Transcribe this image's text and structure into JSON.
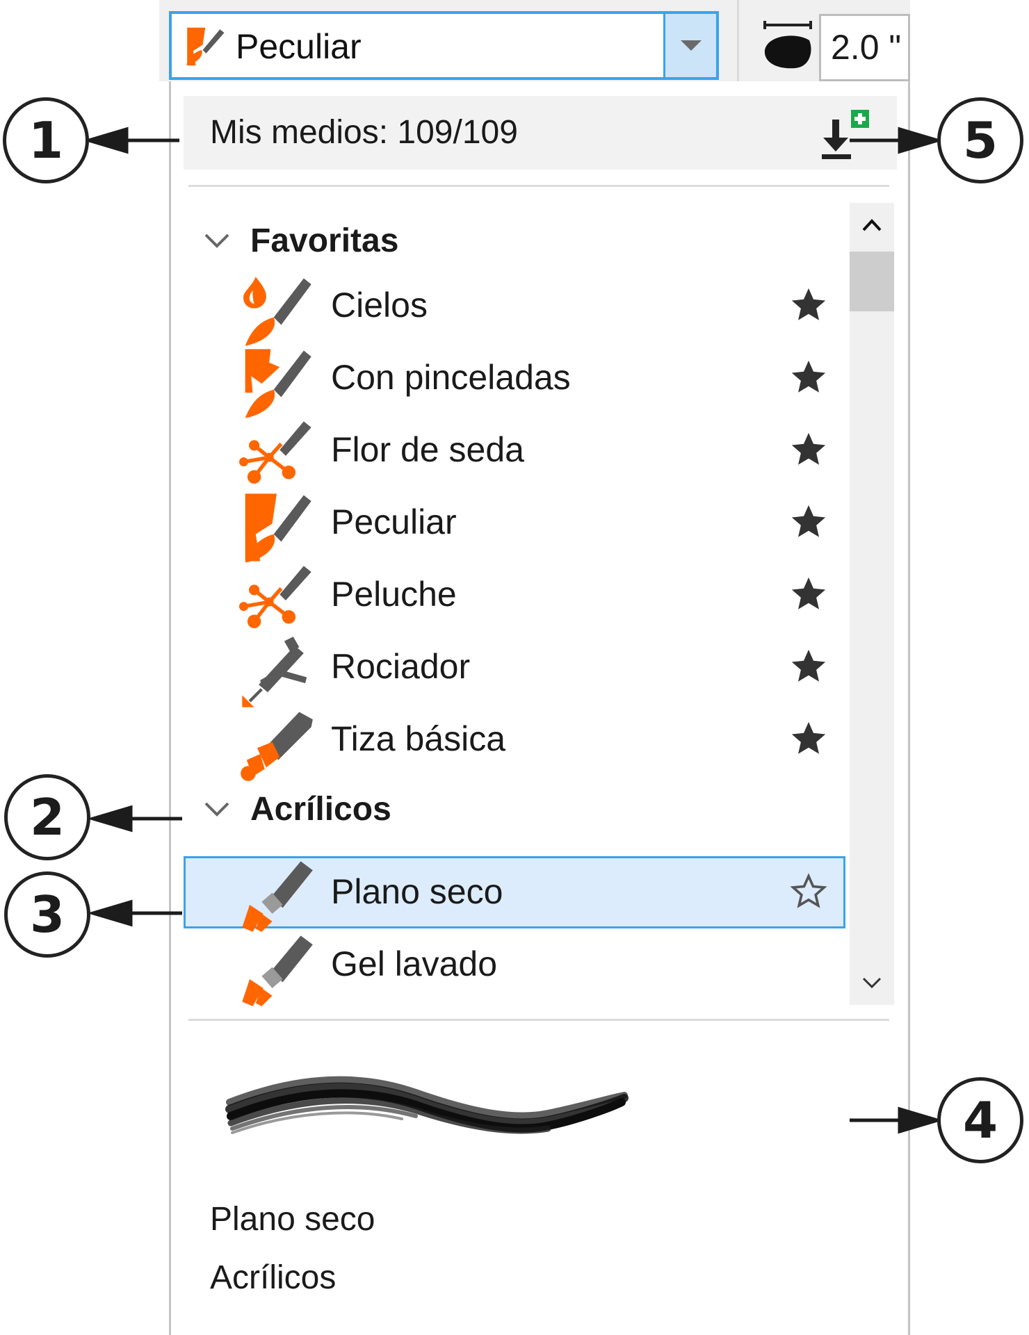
{
  "toolbar": {
    "selected_brush": "Peculiar",
    "nib_size_value": "2.0 \"",
    "icons": {
      "brush": "peculiar-brush-icon",
      "dropdown": "dropdown-arrow-icon",
      "nib_size": "nib-size-icon"
    }
  },
  "panel": {
    "media_count_label": "Mis medios: 109/109",
    "import_icon": "import-add-icon",
    "categories": [
      {
        "label": "Favoritas",
        "items": [
          {
            "label": "Cielos",
            "favorite": true,
            "icon": "cielos-brush-icon"
          },
          {
            "label": "Con pinceladas",
            "favorite": true,
            "icon": "con-pinceladas-brush-icon"
          },
          {
            "label": "Flor de seda",
            "favorite": true,
            "icon": "flor-de-seda-brush-icon"
          },
          {
            "label": "Peculiar",
            "favorite": true,
            "icon": "peculiar-brush-icon"
          },
          {
            "label": "Peluche",
            "favorite": true,
            "icon": "peluche-brush-icon"
          },
          {
            "label": "Rociador",
            "favorite": true,
            "icon": "rociador-brush-icon"
          },
          {
            "label": "Tiza básica",
            "favorite": true,
            "icon": "tiza-basica-brush-icon"
          }
        ]
      },
      {
        "label": "Acrílicos",
        "items": [
          {
            "label": "Plano seco",
            "favorite": false,
            "selected": true,
            "icon": "plano-seco-brush-icon"
          },
          {
            "label": "Gel lavado",
            "favorite": false,
            "icon": "gel-lavado-brush-icon"
          }
        ]
      }
    ],
    "preview": {
      "brush_name": "Plano seco",
      "category_name": "Acrílicos"
    }
  },
  "callouts": [
    "1",
    "2",
    "3",
    "4",
    "5"
  ],
  "colors": {
    "accent_border": "#3aa3ea",
    "selection_fill": "#dcecfc",
    "icon_orange": "#ff6600",
    "icon_gray": "#5a5a5a",
    "import_green": "#1aa84a"
  }
}
